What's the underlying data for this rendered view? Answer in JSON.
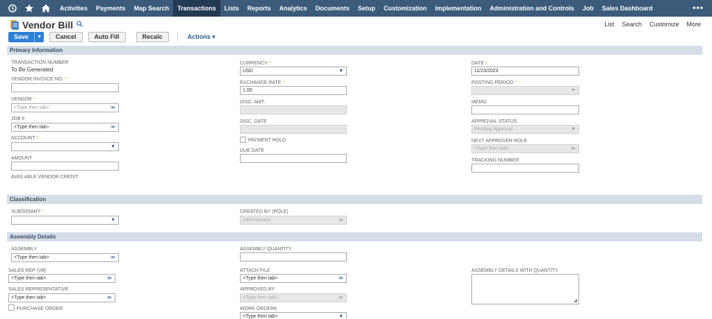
{
  "nav": {
    "items": [
      {
        "label": "Activities"
      },
      {
        "label": "Payments"
      },
      {
        "label": "Map Search"
      },
      {
        "label": "Transactions"
      },
      {
        "label": "Lists"
      },
      {
        "label": "Reports"
      },
      {
        "label": "Analytics"
      },
      {
        "label": "Documents"
      },
      {
        "label": "Setup"
      },
      {
        "label": "Customization"
      },
      {
        "label": "Implementation"
      },
      {
        "label": "Administration and Controls"
      },
      {
        "label": "Job"
      },
      {
        "label": "Sales Dashboard"
      }
    ],
    "active": "Transactions",
    "more": "•••"
  },
  "header": {
    "title": "Vendor Bill",
    "links": [
      "List",
      "Search",
      "Customize",
      "More"
    ]
  },
  "toolbar": {
    "save": "Save",
    "cancel": "Cancel",
    "autofill": "Auto Fill",
    "recalc": "Recalc",
    "actions": "Actions ▾"
  },
  "sections": {
    "primary": "Primary Information",
    "classification": "Classification",
    "assembly": "Assembly Details"
  },
  "primary": {
    "transaction_number_label": "TRANSACTION NUMBER",
    "transaction_number_value": "To Be Generated",
    "vendor_invoice_label": "VENDOR INVOICE NO.",
    "vendor_label": "VENDOR",
    "vendor_placeholder": "<Type then tab>",
    "job_label": "JOB #",
    "job_placeholder": "<Type then tab>",
    "account_label": "ACCOUNT",
    "amount_label": "AMOUNT",
    "available_credit_label": "AVAILABLE VENDOR CREDIT",
    "currency_label": "CURRENCY",
    "currency_value": "USD",
    "exchange_rate_label": "EXCHANGE RATE",
    "exchange_rate_value": "1.00",
    "disc_amt_label": "DISC. AMT.",
    "disc_date_label": "DISC. DATE",
    "payment_hold_label": "PAYMENT HOLD",
    "due_date_label": "DUE DATE",
    "date_label": "DATE",
    "date_value": "11/23/2023",
    "posting_period_label": "POSTING PERIOD",
    "memo_label": "MEMO",
    "approval_status_label": "APPROVAL STATUS",
    "approval_status_value": "Pending Approval",
    "next_approver_label": "NEXT APPROVER ROLE",
    "next_approver_placeholder": "<Type then tab>",
    "tracking_number_label": "TRACKING NUMBER"
  },
  "classification": {
    "subsidiary_label": "SUBSIDIARY",
    "created_by_label": "CREATED BY (ROLE)",
    "created_by_value": "Administrator"
  },
  "assembly": {
    "assembly_label": "ASSEMBLY",
    "assembly_placeholder": "<Type then tab>",
    "assembly_qty_label": "ASSEMBLY QUANTITY",
    "sales_rep_vb_label": "SALES REP (VB)",
    "sales_rep_vb_placeholder": "<Type then tab>",
    "attach_file_label": "ATTACH FILE",
    "attach_file_placeholder": "<Type then tab>",
    "details_with_qty_label": "ASSEMBLY DETAILS WITH QUANTITY",
    "sales_rep_label": "SALES REPRESENTATIVE",
    "sales_rep_placeholder": "<Type then tab>",
    "approved_by_label": "APPROVED BY",
    "approved_by_placeholder": "<Type then tab>",
    "purchase_order_label": "PURCHASE ORDER",
    "work_order_label": "WORK ORDER#",
    "work_order_placeholder": "<Type then tab>"
  },
  "required_mark": "*",
  "colors": {
    "nav_bg": "#3c5a7a",
    "nav_active": "#243a52",
    "primary_button": "#2f7fd4",
    "section_header": "#d4dde8",
    "required": "#e0a800"
  }
}
